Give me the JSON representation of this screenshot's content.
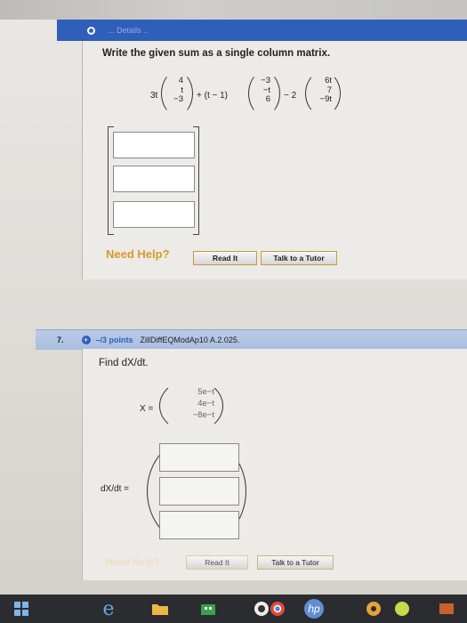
{
  "q6": {
    "header_faded": "...  Details  ..  ",
    "prompt": "Write the given sum as a single column matrix.",
    "coef1": "3t",
    "vec1": [
      "4",
      "t",
      "−3"
    ],
    "op1": "+ (t − 1)",
    "vec2": [
      "−3",
      "−t",
      "6"
    ],
    "op2": "− 2",
    "vec3": [
      "6t",
      "7",
      "−9t"
    ],
    "need_help": "Need Help?",
    "read_it": "Read It",
    "talk_tutor": "Talk to a Tutor"
  },
  "q7": {
    "number": "7.",
    "points": "–/3 points",
    "code": "ZillDiffEQModAp10 A.2.025.",
    "prompt_find": "Find dX/dt.",
    "x_label": "X =",
    "vecX": [
      "5e−t",
      "4e−t",
      "−8e−t"
    ],
    "dx_label": "dX/dt =",
    "need_help": "Need Help?",
    "read_it": "Read It",
    "talk_tutor": "Talk to a Tutor"
  },
  "taskbar": {
    "hp_logo": "hp"
  },
  "colors": {
    "accent": "#2f5fb8",
    "need_help": "#d79a2c"
  }
}
